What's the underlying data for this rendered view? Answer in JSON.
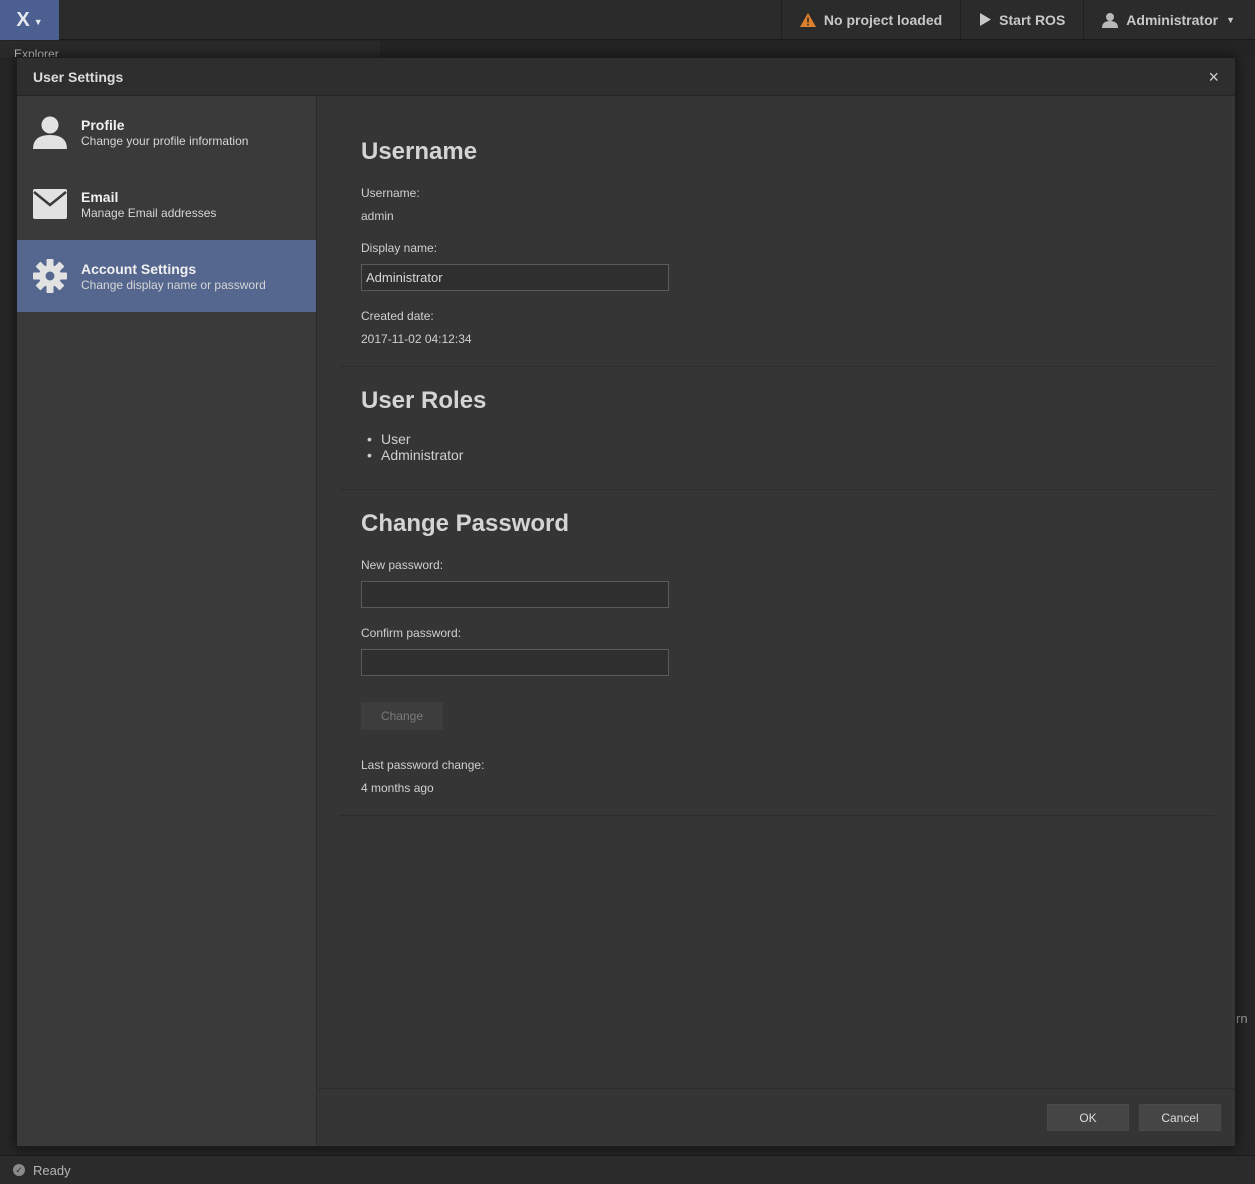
{
  "topbar": {
    "logo_glyph": "X",
    "project_status": "No project loaded",
    "start_ros": "Start ROS",
    "user_menu": "Administrator",
    "warning_color": "#e0812e"
  },
  "background": {
    "explorer_label": "Explorer",
    "partial_text": "rn"
  },
  "dialog": {
    "title": "User Settings",
    "close_glyph": "×"
  },
  "sidebar": {
    "items": [
      {
        "title": "Profile",
        "subtitle": "Change your profile information",
        "icon": "user-icon"
      },
      {
        "title": "Email",
        "subtitle": "Manage Email addresses",
        "icon": "envelope-icon"
      },
      {
        "title": "Account Settings",
        "subtitle": "Change display name or password",
        "icon": "gear-icon"
      }
    ],
    "active_index": 2
  },
  "username_section": {
    "heading": "Username",
    "username_label": "Username:",
    "username_value": "admin",
    "display_name_label": "Display name:",
    "display_name_value": "Administrator",
    "created_label": "Created date:",
    "created_value": "2017-11-02 04:12:34"
  },
  "roles_section": {
    "heading": "User Roles",
    "roles": [
      "User",
      "Administrator"
    ]
  },
  "password_section": {
    "heading": "Change Password",
    "new_label": "New password:",
    "new_value": "",
    "confirm_label": "Confirm password:",
    "confirm_value": "",
    "change_button": "Change",
    "last_change_label": "Last password change:",
    "last_change_value": "4 months ago"
  },
  "footer": {
    "ok": "OK",
    "cancel": "Cancel"
  },
  "statusbar": {
    "text": "Ready"
  },
  "colors": {
    "accent": "#56678f",
    "logo_bg": "#4c5f91"
  }
}
